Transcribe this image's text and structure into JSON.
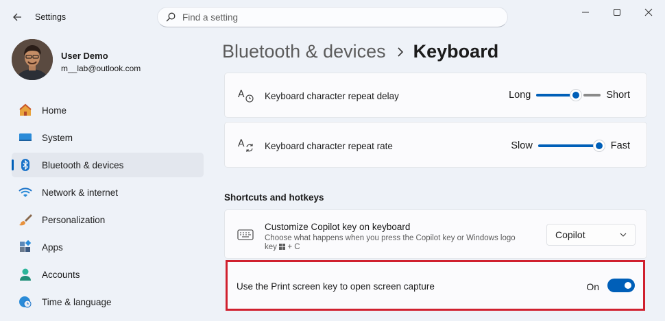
{
  "window": {
    "app_title": "Settings",
    "search_placeholder": "Find a setting"
  },
  "profile": {
    "name": "User Demo",
    "email": "m__lab@outlook.com"
  },
  "sidebar": {
    "items": [
      {
        "label": "Home",
        "icon": "home-icon",
        "selected": false
      },
      {
        "label": "System",
        "icon": "system-icon",
        "selected": false
      },
      {
        "label": "Bluetooth & devices",
        "icon": "bluetooth-icon",
        "selected": true
      },
      {
        "label": "Network & internet",
        "icon": "wifi-icon",
        "selected": false
      },
      {
        "label": "Personalization",
        "icon": "brush-icon",
        "selected": false
      },
      {
        "label": "Apps",
        "icon": "apps-icon",
        "selected": false
      },
      {
        "label": "Accounts",
        "icon": "accounts-icon",
        "selected": false
      },
      {
        "label": "Time & language",
        "icon": "time-language-icon",
        "selected": false
      }
    ]
  },
  "breadcrumb": {
    "parent": "Bluetooth & devices",
    "current": "Keyboard"
  },
  "settings": {
    "repeat_delay": {
      "label": "Keyboard character repeat delay",
      "min_label": "Long",
      "max_label": "Short",
      "value_fraction": 0.65
    },
    "repeat_rate": {
      "label": "Keyboard character repeat rate",
      "min_label": "Slow",
      "max_label": "Fast",
      "value_fraction": 1.0
    }
  },
  "shortcuts": {
    "section_title": "Shortcuts and hotkeys",
    "copilot_key": {
      "label": "Customize Copilot key on keyboard",
      "description_line1": "Choose what happens when you press the Copilot key or Windows logo",
      "description_prefix": "key",
      "description_suffix": "+ C",
      "selected_option": "Copilot"
    },
    "print_screen": {
      "label": "Use the Print screen key to open screen capture",
      "state_label": "On",
      "enabled": true
    }
  },
  "colors": {
    "accent": "#005fb8",
    "highlight_border": "#d0202e",
    "background": "#eef2f8"
  }
}
